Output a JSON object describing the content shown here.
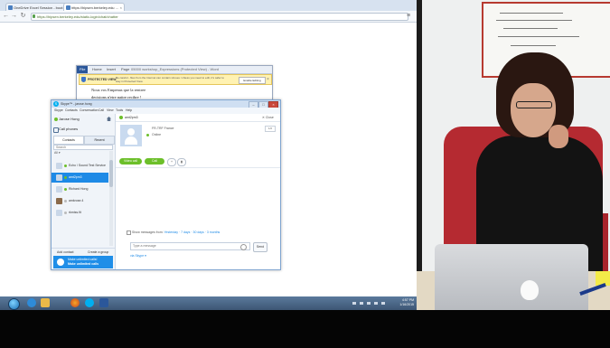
{
  "browser": {
    "tabs": [
      {
        "label": "OneDrive Excel Session - boot..."
      },
      {
        "label": "https://hipsen.berkeley.edu ..."
      }
    ],
    "address": "https://hipsen.berkeley.edu/static-login/chat/chatter",
    "menu_icon": "hamburger-icon"
  },
  "word": {
    "tabs": [
      "File",
      "Home",
      "Insert",
      "Page"
    ],
    "title": "05000 workshop_Expressions (Protected View) - Word",
    "protected_title": "PROTECTED VIEW",
    "protected_message": "Be careful - files from the Internet can contain viruses. Unless you need to edit, it's safer to stay in Protected View.",
    "enable_editing": "Enable Editing",
    "doc_lines": [
      "Nous vos Empenas que la rentree",
      "decisions n'etre naitre recibre !"
    ]
  },
  "skype": {
    "title": "Skype™ - jarose.hong",
    "menu": [
      "Skype",
      "Contacts",
      "Conversation",
      "Call",
      "View",
      "Tools",
      "Help"
    ],
    "user_name": "Jarose Hong",
    "call_phones": "Call phones",
    "tab_contacts": "Contacts",
    "tab_recent": "Recent",
    "search_placeholder": "Search",
    "group_header": "All ▾",
    "contacts": [
      {
        "name": "Echo / Sound Test Service",
        "selected": false
      },
      {
        "name": "amt2pm3",
        "selected": true
      },
      {
        "name": "Richard Hong",
        "selected": false
      },
      {
        "name": "amkrose.4",
        "selected": false
      },
      {
        "name": "rkmiss.fit",
        "selected": false
      }
    ],
    "add_contact": "Add contact",
    "create_group": "Create a group",
    "promo_line1": "Make unlimited calls!",
    "promo_line2": "Make unlimited calls",
    "chat_handle": "amt2pm3",
    "chat_close": "✕ Close",
    "mood": "FR-TRF France",
    "status": "Online",
    "count": "1/2",
    "video_call": "Video call",
    "audio_call": "Call",
    "add_people": "+",
    "show_messages_prefix": "Show messages from:",
    "show_messages_options": "Yesterday · 7 days · 30 days · 3 months",
    "message_placeholder": "Type a message",
    "send": "Send",
    "send_sms": "via Skype ▾"
  },
  "taskbar": {
    "clock_time": "4:57 PM",
    "clock_date": "1/16/2015",
    "icons": [
      "ie-icon",
      "explorer-icon",
      "firefox-icon",
      "skype-icon",
      "word-icon"
    ]
  },
  "colors": {
    "skype_blue": "#00aff0",
    "selected_row": "#1e8ae6",
    "call_green": "#6cbf2a",
    "chair_red": "#b52a31"
  }
}
